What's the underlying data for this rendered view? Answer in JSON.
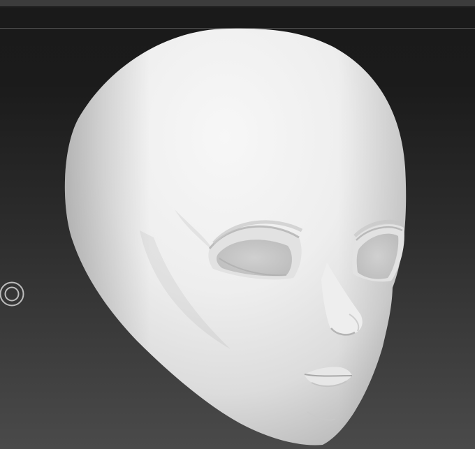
{
  "viewport": {
    "background": "#262626",
    "model_color": "#eaeaea"
  },
  "gizmo": {
    "icon": "double-circle-icon",
    "color": "#bdbdbd"
  }
}
